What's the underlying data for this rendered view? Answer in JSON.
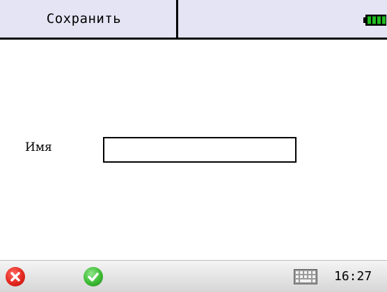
{
  "header": {
    "save_label": "Сохранить",
    "battery_icon": "battery-full-icon"
  },
  "form": {
    "name_label": "Имя",
    "name_value": "",
    "name_placeholder": ""
  },
  "taskbar": {
    "cancel_icon": "close-icon",
    "confirm_icon": "check-icon",
    "keyboard_icon": "keyboard-icon",
    "clock": "16:27"
  },
  "colors": {
    "header_bg": "#e4e4f4",
    "battery_green": "#22bb22",
    "cancel_red": "#e3271f",
    "confirm_green": "#3dbb34"
  }
}
